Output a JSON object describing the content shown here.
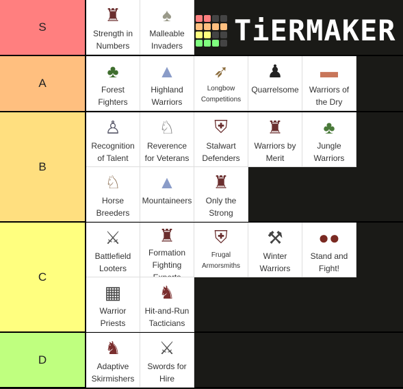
{
  "logo": {
    "text": "TiERMAKER",
    "grid_colors": [
      "#ff7f7f",
      "#ff7f7f",
      "#444",
      "#444",
      "#ffbf7f",
      "#ffbf7f",
      "#ffbf7f",
      "#ffbf7f",
      "#ffff7f",
      "#ffff7f",
      "#444",
      "#444",
      "#7fff7f",
      "#7fff7f",
      "#7fff7f",
      "#444"
    ]
  },
  "tiers": [
    {
      "label": "S",
      "color": "#ff7f7f",
      "height": 82,
      "items": [
        {
          "name": "Strength in Numbers",
          "icon": "warriors-icon"
        },
        {
          "name": "Malleable Invaders",
          "icon": "birds-icon"
        }
      ]
    },
    {
      "label": "A",
      "color": "#ffbf7f",
      "height": 82,
      "items": [
        {
          "name": "Forest Fighters",
          "icon": "forest-icon"
        },
        {
          "name": "Highland Warriors",
          "icon": "mountain-icon"
        },
        {
          "name": "Longbow Competitions",
          "icon": "bow-icon"
        },
        {
          "name": "Quarrelsome",
          "icon": "figure-icon"
        },
        {
          "name": "Warriors of the Dry",
          "icon": "desert-icon"
        }
      ]
    },
    {
      "label": "B",
      "color": "#ffdf7f",
      "height": 161,
      "items": [
        {
          "name": "Recognition of Talent",
          "icon": "handshake-icon"
        },
        {
          "name": "Reverence for Veterans",
          "icon": "cavalry-icon"
        },
        {
          "name": "Stalwart Defenders",
          "icon": "shield-warrior-icon"
        },
        {
          "name": "Warriors by Merit",
          "icon": "warriors-icon"
        },
        {
          "name": "Jungle Warriors",
          "icon": "jungle-icon"
        },
        {
          "name": "Horse Breeders",
          "icon": "horse-icon"
        },
        {
          "name": "Mountaineers",
          "icon": "mountain-icon"
        },
        {
          "name": "Only the Strong",
          "icon": "warriors-icon"
        }
      ]
    },
    {
      "label": "C",
      "color": "#ffff7f",
      "height": 161,
      "items": [
        {
          "name": "Battlefield Looters",
          "icon": "crossed-swords-icon"
        },
        {
          "name": "Formation Fighting Experts",
          "icon": "warriors-icon"
        },
        {
          "name": "Frugal Armorsmiths",
          "icon": "shield-warrior-icon"
        },
        {
          "name": "Winter Warriors",
          "icon": "crossed-axes-icon"
        },
        {
          "name": "Stand and Fight!",
          "icon": "shields-icon"
        },
        {
          "name": "Warrior Priests",
          "icon": "temple-icon"
        },
        {
          "name": "Hit-and-Run Tacticians",
          "icon": "archers-icon"
        }
      ]
    },
    {
      "label": "D",
      "color": "#bfff7f",
      "height": 81,
      "items": [
        {
          "name": "Adaptive Skirmishers",
          "icon": "archers-icon"
        },
        {
          "name": "Swords for Hire",
          "icon": "crossed-swords-icon"
        }
      ]
    }
  ]
}
